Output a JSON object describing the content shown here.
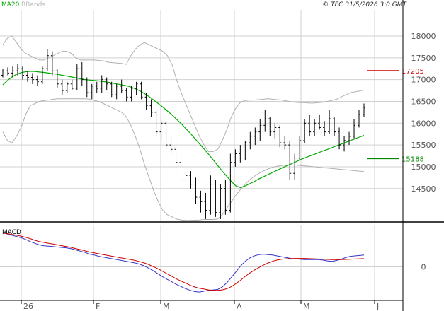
{
  "header": {
    "legend_ma": "MA20",
    "legend_bbands": "BBands",
    "copyright": "© TEC 31/5/2026 3:0 GMT"
  },
  "macd_label": "MACD",
  "colors": {
    "ma": "#00aa00",
    "bbands": "#b0b0b0",
    "candles": "#000000",
    "macd": "#3333cc",
    "signal": "#cc0000",
    "resistance": "#cc0000",
    "support": "#008800",
    "grid": "#d0d0d0"
  },
  "chart_data": [
    {
      "type": "ohlc",
      "title": "",
      "x_ticks": [
        "26",
        "F",
        "M",
        "A",
        "M",
        "J"
      ],
      "y_ticks": [
        14500,
        15000,
        15500,
        16000,
        16500,
        17000,
        17500,
        18000
      ],
      "y_tick_labels": [
        "14500",
        "15000",
        "15500",
        "16000",
        "16500",
        "17000",
        "17500",
        "18000"
      ],
      "ylim": [
        13750,
        18600
      ],
      "levels": [
        {
          "name": "resistance",
          "value": 17205,
          "label": "17205"
        },
        {
          "name": "support",
          "value": 15188,
          "label": "15188"
        }
      ],
      "series": [
        {
          "name": "price",
          "values": [
            [
              17100,
              17250,
              17050,
              17200
            ],
            [
              17200,
              17280,
              17100,
              17150
            ],
            [
              17150,
              17300,
              17050,
              17200
            ],
            [
              17200,
              17350,
              17100,
              17250
            ],
            [
              17250,
              17300,
              17000,
              17100
            ],
            [
              17100,
              17200,
              16950,
              17050
            ],
            [
              17050,
              17150,
              16900,
              17000
            ],
            [
              17000,
              17100,
              16850,
              16950
            ],
            [
              16950,
              17300,
              16900,
              17250
            ],
            [
              17250,
              17700,
              17200,
              17550
            ],
            [
              17550,
              17650,
              17100,
              17200
            ],
            [
              17200,
              17250,
              16800,
              16900
            ],
            [
              16900,
              17000,
              16650,
              16750
            ],
            [
              16750,
              16950,
              16700,
              16900
            ],
            [
              16900,
              17000,
              16750,
              16800
            ],
            [
              16800,
              17350,
              16750,
              17250
            ],
            [
              17250,
              17400,
              16850,
              17000
            ],
            [
              17000,
              17050,
              16600,
              16700
            ],
            [
              16700,
              16900,
              16550,
              16850
            ],
            [
              16850,
              16950,
              16700,
              16800
            ],
            [
              16800,
              17100,
              16700,
              17000
            ],
            [
              17000,
              17050,
              16750,
              16900
            ],
            [
              16900,
              16950,
              16600,
              16650
            ],
            [
              16650,
              16900,
              16550,
              16850
            ],
            [
              16850,
              17000,
              16700,
              16750
            ],
            [
              16750,
              16800,
              16500,
              16600
            ],
            [
              16600,
              16850,
              16500,
              16800
            ],
            [
              16800,
              16950,
              16650,
              16900
            ],
            [
              16900,
              16950,
              16550,
              16600
            ],
            [
              16600,
              16700,
              16300,
              16400
            ],
            [
              16400,
              16550,
              16150,
              16250
            ],
            [
              16250,
              16300,
              15700,
              15800
            ],
            [
              15800,
              16100,
              15600,
              16000
            ],
            [
              16000,
              16050,
              15400,
              15500
            ],
            [
              15500,
              15700,
              15250,
              15400
            ],
            [
              15400,
              15600,
              14900,
              15100
            ],
            [
              15100,
              15200,
              14600,
              14700
            ],
            [
              14700,
              14900,
              14400,
              14800
            ],
            [
              14800,
              14900,
              14500,
              14600
            ],
            [
              14600,
              14750,
              14150,
              14300
            ],
            [
              14300,
              14450,
              13950,
              14200
            ],
            [
              14200,
              14400,
              13800,
              14000
            ],
            [
              14000,
              14800,
              13900,
              14600
            ],
            [
              14600,
              14700,
              13850,
              13950
            ],
            [
              13950,
              14600,
              13800,
              14500
            ],
            [
              14500,
              14700,
              13900,
              14000
            ],
            [
              14000,
              15300,
              13950,
              15100
            ],
            [
              15100,
              15400,
              15000,
              15300
            ],
            [
              15300,
              15500,
              15100,
              15200
            ],
            [
              15200,
              15600,
              15150,
              15550
            ],
            [
              15550,
              15800,
              15400,
              15700
            ],
            [
              15700,
              15900,
              15500,
              15800
            ],
            [
              15800,
              16100,
              15600,
              15950
            ],
            [
              15950,
              16300,
              15800,
              16100
            ],
            [
              16100,
              16150,
              15700,
              15800
            ],
            [
              15800,
              16000,
              15650,
              15900
            ],
            [
              15900,
              15950,
              15450,
              15550
            ],
            [
              15550,
              15700,
              15400,
              15500
            ],
            [
              15500,
              15600,
              14700,
              14850
            ],
            [
              14850,
              15300,
              14700,
              15200
            ],
            [
              15200,
              15700,
              15150,
              15600
            ],
            [
              15600,
              16100,
              15550,
              16000
            ],
            [
              16000,
              16200,
              15700,
              15800
            ],
            [
              15800,
              16100,
              15700,
              16000
            ],
            [
              16000,
              16200,
              15850,
              15900
            ],
            [
              15900,
              16050,
              15700,
              15800
            ],
            [
              15800,
              16300,
              15750,
              16100
            ],
            [
              16100,
              16150,
              15700,
              15800
            ],
            [
              15800,
              15900,
              15400,
              15500
            ],
            [
              15500,
              15700,
              15350,
              15600
            ],
            [
              15600,
              15800,
              15500,
              15700
            ],
            [
              15700,
              16100,
              15650,
              15950
            ],
            [
              15950,
              16300,
              15900,
              16200
            ],
            [
              16200,
              16450,
              16150,
              16350
            ]
          ]
        },
        {
          "name": "MA20",
          "values": [
            16880,
            16980,
            17060,
            17120,
            17160,
            17180,
            17190,
            17185,
            17175,
            17165,
            17150,
            17135,
            17120,
            17100,
            17080,
            17060,
            17040,
            17020,
            17000,
            16990,
            16980,
            16970,
            16955,
            16940,
            16920,
            16900,
            16880,
            16860,
            16830,
            16790,
            16740,
            16680,
            16610,
            16530,
            16450,
            16370,
            16280,
            16190,
            16090,
            15990,
            15880,
            15770,
            15650,
            15530,
            15410,
            15290,
            15160,
            15030,
            14900,
            14780,
            14660,
            14560,
            14520,
            14560,
            14610,
            14660,
            14720,
            14770,
            14820,
            14870,
            14920,
            14970,
            15020,
            15060,
            15110,
            15160,
            15200,
            15240,
            15280,
            15320,
            15360,
            15400,
            15440,
            15480,
            15520,
            15560,
            15600,
            15640,
            15680,
            15720
          ]
        },
        {
          "name": "BBands upper",
          "values": [
            17800,
            17950,
            18000,
            17850,
            17700,
            17600,
            17550,
            17500,
            17450,
            17450,
            17500,
            17550,
            17600,
            17650,
            17650,
            17600,
            17500,
            17450,
            17450,
            17450,
            17450,
            17440,
            17430,
            17400,
            17390,
            17380,
            17370,
            17350,
            17550,
            17700,
            17800,
            17850,
            17800,
            17750,
            17700,
            17650,
            17550,
            17350,
            17000,
            16700,
            16450,
            16200,
            15950,
            15700,
            15500,
            15350,
            15350,
            15400,
            15600,
            15850,
            16150,
            16350,
            16480,
            16520,
            16530,
            16530,
            16540,
            16550,
            16560,
            16550,
            16540,
            16530,
            16510,
            16490,
            16480,
            16470,
            16470,
            16460,
            16460,
            16470,
            16480,
            16500,
            16520,
            16550,
            16600,
            16650,
            16700,
            16720,
            16740,
            16760
          ]
        },
        {
          "name": "BBands lower",
          "values": [
            15800,
            15600,
            15550,
            15700,
            15900,
            16200,
            16400,
            16450,
            16500,
            16520,
            16530,
            16550,
            16560,
            16560,
            16560,
            16560,
            16560,
            16560,
            16560,
            16550,
            16520,
            16500,
            16450,
            16400,
            16350,
            16300,
            16250,
            16150,
            15950,
            15700,
            15400,
            15050,
            14750,
            14450,
            14200,
            14000,
            13900,
            13850,
            13800,
            13780,
            13770,
            13770,
            13775,
            13780,
            13790,
            13790,
            13790,
            13800,
            13900,
            14050,
            14200,
            14350,
            14480,
            14600,
            14700,
            14780,
            14850,
            14900,
            14950,
            14990,
            15010,
            15030,
            15040,
            15040,
            15040,
            15030,
            15020,
            15010,
            15000,
            14990,
            14980,
            14970,
            14960,
            14950,
            14940,
            14930,
            14920,
            14910,
            14900,
            14890
          ]
        }
      ]
    },
    {
      "type": "line",
      "title": "MACD",
      "y_ticks": [
        0
      ],
      "y_tick_labels": [
        "0"
      ],
      "ylim": [
        -800,
        1000
      ],
      "series": [
        {
          "name": "macd",
          "values": [
            820,
            780,
            750,
            720,
            690,
            650,
            600,
            560,
            520,
            500,
            490,
            480,
            470,
            460,
            450,
            430,
            400,
            370,
            340,
            300,
            280,
            250,
            230,
            210,
            190,
            170,
            150,
            130,
            110,
            90,
            60,
            20,
            -40,
            -100,
            -170,
            -240,
            -300,
            -360,
            -420,
            -470,
            -520,
            -560,
            -590,
            -600,
            -580,
            -560,
            -550,
            -540,
            -480,
            -380,
            -250,
            -120,
            20,
            130,
            210,
            260,
            290,
            300,
            290,
            280,
            260,
            240,
            220,
            200,
            190,
            180,
            170,
            170,
            170,
            170,
            160,
            140,
            130,
            150,
            180,
            220,
            250,
            260,
            270,
            280
          ]
        },
        {
          "name": "signal",
          "values": [
            800,
            790,
            770,
            750,
            730,
            700,
            670,
            630,
            600,
            580,
            560,
            540,
            520,
            500,
            480,
            460,
            430,
            410,
            380,
            350,
            330,
            310,
            290,
            270,
            250,
            230,
            210,
            190,
            170,
            150,
            120,
            90,
            50,
            0,
            -50,
            -110,
            -170,
            -230,
            -290,
            -340,
            -390,
            -440,
            -480,
            -510,
            -530,
            -550,
            -560,
            -560,
            -550,
            -520,
            -470,
            -400,
            -320,
            -230,
            -150,
            -80,
            -20,
            40,
            90,
            130,
            160,
            180,
            190,
            195,
            200,
            200,
            200,
            195,
            190,
            185,
            180,
            175,
            170,
            170,
            170,
            175,
            180,
            185,
            190,
            195
          ]
        }
      ]
    }
  ]
}
